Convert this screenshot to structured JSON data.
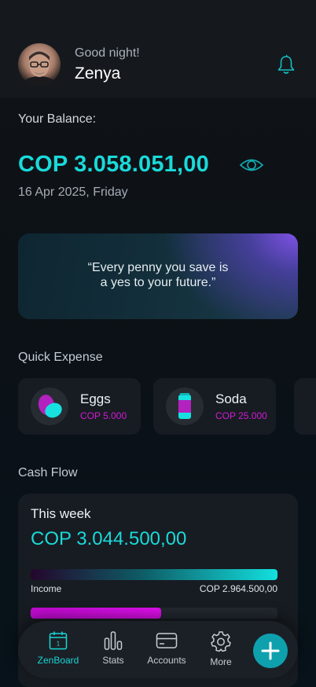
{
  "header": {
    "greeting": "Good night!",
    "username": "Zenya"
  },
  "balance": {
    "label": "Your Balance:",
    "amount": "COP 3.058.051,00",
    "date": "16 Apr 2025, Friday"
  },
  "quote": {
    "line1": "“Every penny you save is",
    "line2": "a yes to your future.”"
  },
  "quick_expense": {
    "title": "Quick Expense",
    "items": [
      {
        "name": "Eggs",
        "price": "COP 5.000",
        "icon": "eggs-icon"
      },
      {
        "name": "Soda",
        "price": "COP 25.000",
        "icon": "soda-can-icon"
      }
    ]
  },
  "cash_flow": {
    "title": "Cash Flow",
    "period": "This week",
    "amount": "COP 3.044.500,00",
    "income": {
      "label": "Income",
      "value": "COP 2.964.500,00",
      "fill": 1.0
    },
    "expense": {
      "fill": 0.53
    }
  },
  "nav": {
    "items": [
      {
        "label": "ZenBoard",
        "icon": "calendar-icon",
        "active": true
      },
      {
        "label": "Stats",
        "icon": "bar-chart-icon"
      },
      {
        "label": "Accounts",
        "icon": "card-icon"
      },
      {
        "label": "More",
        "icon": "gear-icon"
      }
    ],
    "fab_icon": "plus-icon"
  },
  "colors": {
    "accent": "#1ad9d9",
    "magenta": "#d21ad6"
  }
}
